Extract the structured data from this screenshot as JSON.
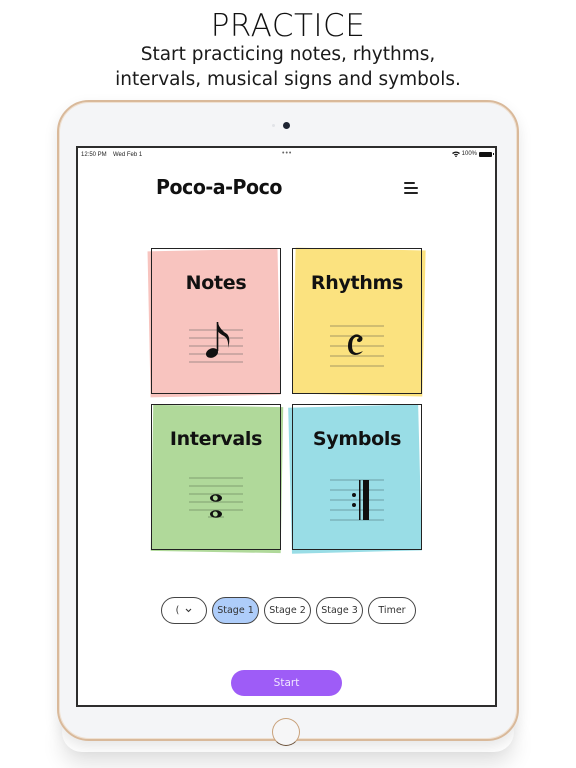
{
  "promo": {
    "headline": "PRACTICE",
    "subline_1": "Start practicing notes, rhythms,",
    "subline_2": "intervals, musical signs and symbols."
  },
  "status_bar": {
    "time": "12:50 PM",
    "date": "Wed Feb 1",
    "multitask_dots": "•••",
    "battery_text": "100%"
  },
  "app": {
    "logo": "Poco-a-Poco",
    "menu_icon": "hamburger-menu-icon"
  },
  "cards": [
    {
      "label": "Notes",
      "color": "#f8c4bf",
      "icon": "eighth-note-icon"
    },
    {
      "label": "Rhythms",
      "color": "#fbe27f",
      "icon": "common-time-icon"
    },
    {
      "label": "Intervals",
      "color": "#b0d99a",
      "icon": "whole-notes-interval-icon"
    },
    {
      "label": "Symbols",
      "color": "#99dde6",
      "icon": "repeat-sign-icon"
    }
  ],
  "options": {
    "key_selector": {
      "value": "(",
      "icon": "chevron-down-icon"
    },
    "stages": [
      {
        "label": "Stage 1",
        "selected": true
      },
      {
        "label": "Stage 2",
        "selected": false
      },
      {
        "label": "Stage 3",
        "selected": false
      }
    ],
    "timer_label": "Timer",
    "selected_color": "#aecdfa"
  },
  "start_button": {
    "label": "Start",
    "color": "#9e5cf7"
  }
}
